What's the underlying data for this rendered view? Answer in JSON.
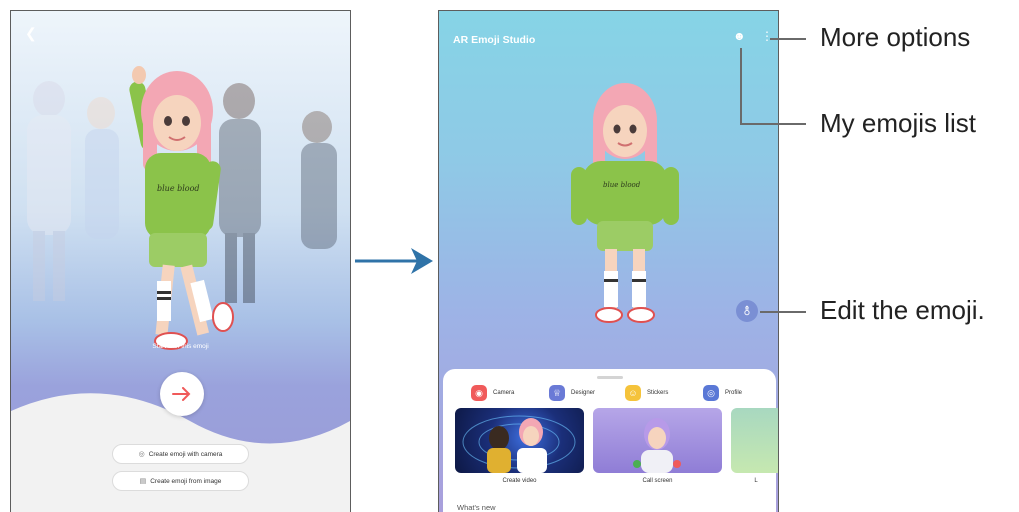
{
  "left_screen": {
    "start_text": "Start with this emoji",
    "create_with_camera": "Create emoji with camera",
    "create_from_image": "Create emoji from image"
  },
  "right_screen": {
    "app_title": "AR Emoji Studio",
    "categories": [
      {
        "label": "Camera",
        "icon": "camera-icon",
        "color": "#f05a5a"
      },
      {
        "label": "Designer",
        "icon": "designer-icon",
        "color": "#6a7ad6"
      },
      {
        "label": "Stickers",
        "icon": "sticker-icon",
        "color": "#f5c33b"
      },
      {
        "label": "Profile",
        "icon": "profile-icon",
        "color": "#5a78d6"
      }
    ],
    "cards": [
      {
        "label": "Create video"
      },
      {
        "label": "Call screen"
      },
      {
        "label": "L"
      }
    ],
    "whats_new": "What's new"
  },
  "callouts": {
    "more_options": "More options",
    "my_emojis_list": "My emojis list",
    "edit_emoji": "Edit the emoji."
  },
  "colors": {
    "flow_arrow": "#2f73a8",
    "frame_border": "#5d5d5d",
    "accent_red": "#f05a5a"
  }
}
